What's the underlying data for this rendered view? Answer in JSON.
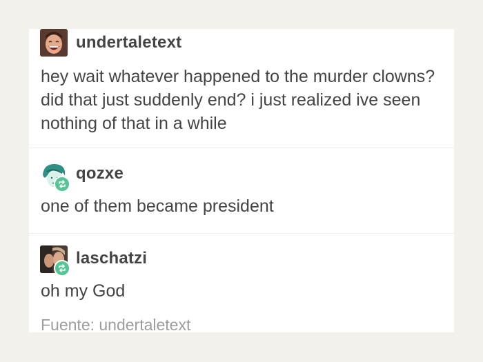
{
  "posts": [
    {
      "username": "undertaletext",
      "text": "hey wait whatever happened to the murder clowns? did that just suddenly end? i just realized ive seen nothing of that in a while",
      "avatar_icon": "laughing-face-avatar",
      "reblog": false
    },
    {
      "username": "qozxe",
      "text": "one of them became president",
      "avatar_icon": "cartoon-girl-avatar",
      "reblog": true
    },
    {
      "username": "laschatzi",
      "text": "oh my God",
      "avatar_icon": "photo-avatar",
      "reblog": true
    }
  ],
  "source_label": "Fuente: undertaletext",
  "colors": {
    "background": "#f3f1ec",
    "card": "#ffffff",
    "text": "#444444",
    "muted": "#9c9c9c",
    "reblog": "#56c596"
  }
}
